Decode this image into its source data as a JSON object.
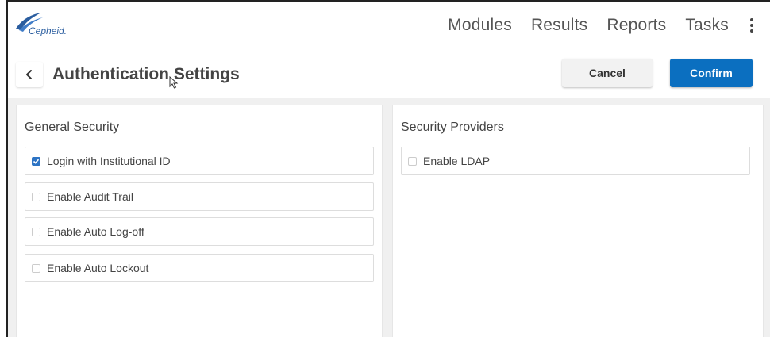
{
  "brand": {
    "logo_text": "Cepheid.",
    "accent": "#0b6fc0"
  },
  "nav": {
    "items": [
      {
        "label": "Modules"
      },
      {
        "label": "Results"
      },
      {
        "label": "Reports"
      },
      {
        "label": "Tasks"
      }
    ],
    "more_icon": "kebab-vertical-icon"
  },
  "header": {
    "back_icon": "chevron-left-icon",
    "title": "Authentication Settings",
    "cancel_label": "Cancel",
    "confirm_label": "Confirm"
  },
  "general_security": {
    "title": "General Security",
    "options": [
      {
        "label": "Login with Institutional ID",
        "checked": true
      },
      {
        "label": "Enable Audit Trail",
        "checked": false
      },
      {
        "label": "Enable Auto Log-off",
        "checked": false
      },
      {
        "label": "Enable Auto Lockout",
        "checked": false
      }
    ]
  },
  "security_providers": {
    "title": "Security Providers",
    "options": [
      {
        "label": "Enable LDAP",
        "checked": false
      }
    ]
  }
}
